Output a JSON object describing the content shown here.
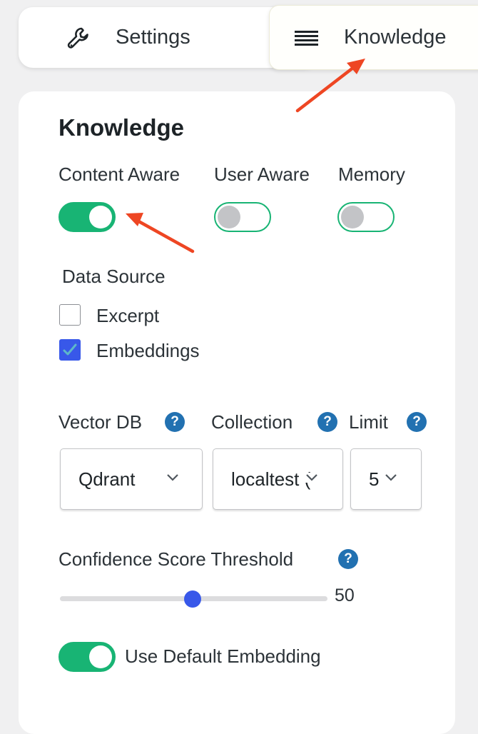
{
  "tabs": {
    "settings": {
      "label": "Settings",
      "icon": "wrench-icon"
    },
    "knowledge": {
      "label": "Knowledge",
      "icon": "menu-lines-icon"
    }
  },
  "panel": {
    "title": "Knowledge",
    "toggles": [
      {
        "label": "Content Aware",
        "on": true
      },
      {
        "label": "User Aware",
        "on": false
      },
      {
        "label": "Memory",
        "on": false
      }
    ],
    "data_source": {
      "label": "Data Source",
      "options": [
        {
          "label": "Excerpt",
          "checked": false
        },
        {
          "label": "Embeddings",
          "checked": true
        }
      ]
    },
    "fields": {
      "vector_db": {
        "label": "Vector DB",
        "help": "?",
        "value": "Qdrant"
      },
      "collection": {
        "label": "Collection",
        "help": "?",
        "value": "localtest ("
      },
      "limit": {
        "label": "Limit",
        "help": "?",
        "value": "5"
      }
    },
    "confidence": {
      "label": "Confidence Score Threshold",
      "help": "?",
      "value": "50",
      "fraction": 0.5
    },
    "default_embedding": {
      "label": "Use Default Embedding",
      "on": true
    }
  },
  "colors": {
    "accent_green": "#18b474",
    "accent_blue": "#3858e9",
    "help_blue": "#2271b1",
    "annotation_arrow": "#ee4623"
  }
}
